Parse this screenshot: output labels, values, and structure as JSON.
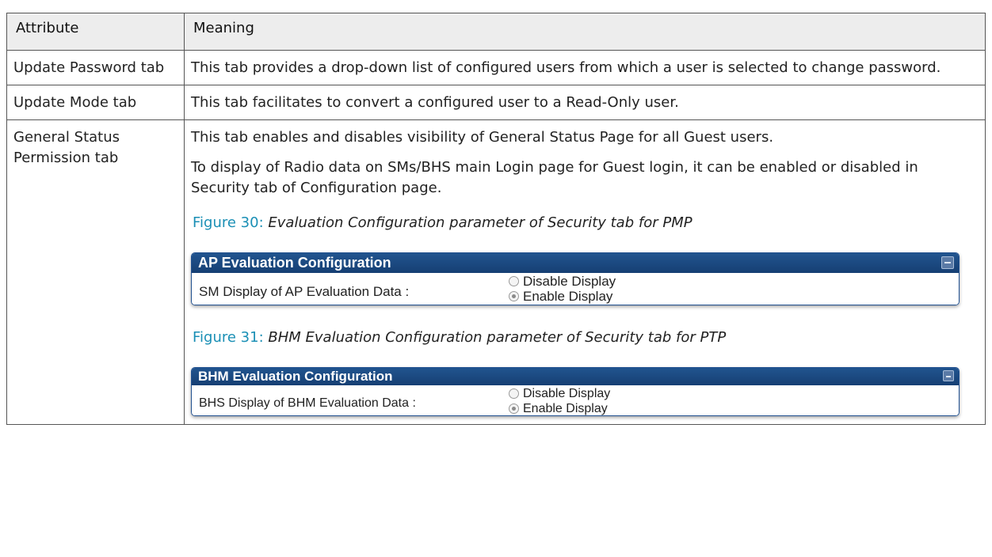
{
  "table": {
    "headers": [
      "Attribute",
      "Meaning"
    ],
    "rows": [
      {
        "attribute": "Update Password tab",
        "meaning": [
          "This tab provides a drop-down list of configured users from which a user is selected to change password."
        ]
      },
      {
        "attribute": "Update Mode tab",
        "meaning": [
          "This tab facilitates to convert a configured user to a Read-Only user."
        ]
      },
      {
        "attribute": "General Status Permission tab",
        "meaning": [
          "This tab enables and disables visibility of General Status Page for all Guest users.",
          "To display of Radio data on SMs/BHS main Login page for Guest login, it can be enabled or disabled in Security tab of Configuration page."
        ]
      }
    ]
  },
  "figures": [
    {
      "number": "Figure 30:",
      "title": "Evaluation Configuration parameter of Security tab for PMP",
      "panel": {
        "title": "AP Evaluation Configuration",
        "label": "SM Display of AP Evaluation Data :",
        "options": [
          {
            "label": "Disable Display",
            "checked": false
          },
          {
            "label": "Enable Display",
            "checked": true
          }
        ]
      }
    },
    {
      "number": "Figure 31:",
      "title": "BHM Evaluation Configuration parameter of Security tab for PTP",
      "panel": {
        "title": "BHM Evaluation Configuration",
        "label": "BHS Display of BHM Evaluation Data :",
        "options": [
          {
            "label": "Disable Display",
            "checked": false
          },
          {
            "label": "Enable Display",
            "checked": true
          }
        ]
      }
    }
  ],
  "colors": {
    "figure_number": "#1a8fb5",
    "panel_header": "#1c4a85",
    "header_bg": "#ededed"
  }
}
